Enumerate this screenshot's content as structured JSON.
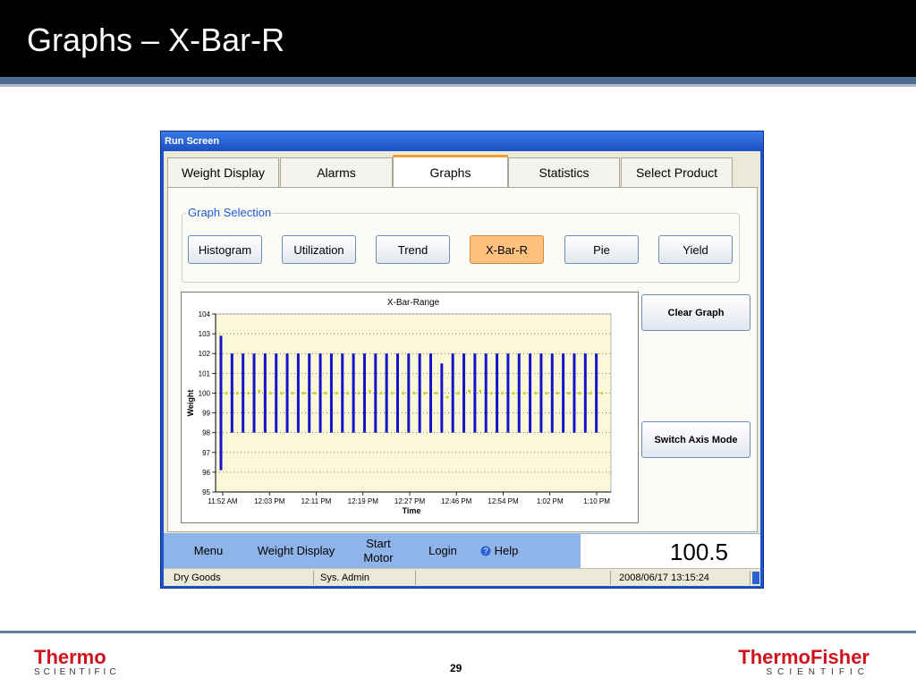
{
  "slide": {
    "title": "Graphs – X-Bar-R",
    "page_number": "29",
    "logo_left": {
      "brand": "Thermo",
      "sub": "SCIENTIFIC"
    },
    "logo_right": {
      "brand": "ThermoFisher",
      "sub": "SCIENTIFIC"
    }
  },
  "window": {
    "title": "Run Screen",
    "tabs": [
      {
        "label": "Weight Display",
        "active": false
      },
      {
        "label": "Alarms",
        "active": false
      },
      {
        "label": "Graphs",
        "active": true
      },
      {
        "label": "Statistics",
        "active": false
      },
      {
        "label": "Select Product",
        "active": false
      }
    ],
    "graph_selection": {
      "legend": "Graph Selection",
      "buttons": [
        {
          "label": "Histogram",
          "active": false
        },
        {
          "label": "Utilization",
          "active": false
        },
        {
          "label": "Trend",
          "active": false
        },
        {
          "label": "X-Bar-R",
          "active": true
        },
        {
          "label": "Pie",
          "active": false
        },
        {
          "label": "Yield",
          "active": false
        }
      ]
    },
    "side_buttons": {
      "clear_graph": "Clear Graph",
      "switch_axis": "Switch Axis Mode"
    },
    "menu": {
      "menu": "Menu",
      "weight_display": "Weight Display",
      "start_motor_line1": "Start",
      "start_motor_line2": "Motor",
      "login": "Login",
      "help": "Help",
      "display_value": "100.5"
    },
    "status": {
      "product": "Dry Goods",
      "user": "Sys. Admin",
      "message": "",
      "datetime": "2008/06/17 13:15:24"
    }
  },
  "colors": {
    "bar": "#1414c8",
    "mean_point": "#c8d820",
    "plot_bg": "#fbf8d8",
    "accent": "#ffc27e"
  },
  "chart_data": {
    "type": "range",
    "title": "X-Bar-Range",
    "xlabel": "Time",
    "ylabel": "Weight",
    "ylim": [
      95,
      104
    ],
    "yticks": [
      95,
      96,
      97,
      98,
      99,
      100,
      101,
      102,
      103,
      104
    ],
    "xtick_labels": [
      "11:52 AM",
      "12:03 PM",
      "12:11 PM",
      "12:19 PM",
      "12:27 PM",
      "12:46 PM",
      "12:54 PM",
      "1:02 PM",
      "1:10 PM"
    ],
    "grid": true,
    "series": [
      {
        "name": "Range",
        "low": [
          96.1,
          98.0,
          98.0,
          98.0,
          98.0,
          98.0,
          98.0,
          98.0,
          98.0,
          98.0,
          98.0,
          98.0,
          98.0,
          98.0,
          98.0,
          98.0,
          98.0,
          98.0,
          98.0,
          98.0,
          98.0,
          98.0,
          98.0,
          98.0,
          98.0,
          98.0,
          98.0,
          98.0,
          98.0,
          98.0,
          98.0,
          98.0,
          98.0,
          98.0,
          98.0
        ],
        "high": [
          102.9,
          102.0,
          102.0,
          102.0,
          102.0,
          102.0,
          102.0,
          102.0,
          102.0,
          102.0,
          102.0,
          102.0,
          102.0,
          102.0,
          102.0,
          102.0,
          102.0,
          102.0,
          102.0,
          102.0,
          101.5,
          102.0,
          102.0,
          102.0,
          102.0,
          102.0,
          102.0,
          102.0,
          102.0,
          102.0,
          102.0,
          102.0,
          102.0,
          102.0,
          102.0
        ]
      },
      {
        "name": "X-Bar",
        "values": [
          100.0,
          100.0,
          100.0,
          100.1,
          100.0,
          100.0,
          100.0,
          100.0,
          100.0,
          100.0,
          100.0,
          100.0,
          100.0,
          100.1,
          100.0,
          100.0,
          100.0,
          100.0,
          100.0,
          100.0,
          99.8,
          100.0,
          100.1,
          100.1,
          100.0,
          100.0,
          100.0,
          100.0,
          100.0,
          100.0,
          100.0,
          100.0,
          100.0,
          100.0,
          100.0
        ]
      }
    ]
  }
}
